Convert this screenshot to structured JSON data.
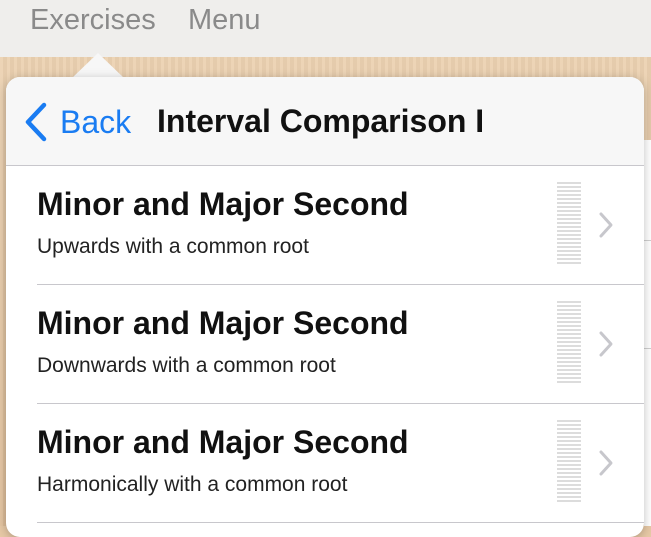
{
  "topbar": {
    "items": [
      "Exercises",
      "Menu"
    ]
  },
  "nav": {
    "back_label": "Back",
    "title": "Interval Comparison I"
  },
  "rows": [
    {
      "title": "Minor and Major Second",
      "subtitle": "Upwards with a common root",
      "progress": 0
    },
    {
      "title": "Minor and Major Second",
      "subtitle": "Downwards with a common root",
      "progress": 0
    },
    {
      "title": "Minor and Major Second",
      "subtitle": "Harmonically with a common root",
      "progress": 0
    }
  ],
  "colors": {
    "accent": "#1a7cf2",
    "topbar_text": "#8a8a8a"
  },
  "icons": {
    "back": "chevron-left-icon",
    "disclosure": "chevron-right-icon"
  }
}
